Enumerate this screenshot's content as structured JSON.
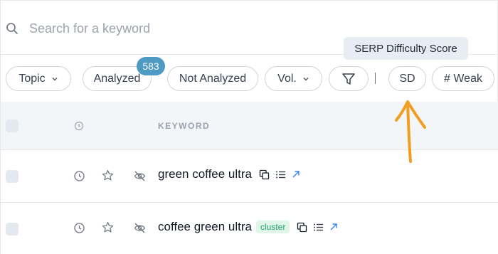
{
  "search": {
    "placeholder": "Search for a keyword",
    "value": ""
  },
  "tooltip": {
    "text": "SERP Difficulty Score"
  },
  "filters": {
    "topic_label": "Topic",
    "analyzed_label": "Analyzed",
    "analyzed_count": "583",
    "not_analyzed_label": "Not Analyzed",
    "volume_label": "Vol.",
    "divider": "|",
    "sd_label": "SD",
    "weak_label": "# Weak"
  },
  "table": {
    "header": {
      "keyword": "KEYWORD"
    },
    "rows": [
      {
        "keyword": "green coffee ultra",
        "tag": ""
      },
      {
        "keyword": "coffee green ultra",
        "tag": "cluster"
      }
    ]
  },
  "colors": {
    "badge": "#4e9ac2",
    "annotation_arrow": "#f29d1f",
    "tag_text": "#22a06b",
    "tag_bg": "#dff6e8",
    "link_icon": "#3b82f6"
  },
  "icons": [
    "search-icon",
    "chevron-down-icon",
    "filter-icon",
    "clock-icon",
    "star-icon",
    "eye-off-icon",
    "copy-icon",
    "list-icon",
    "external-link-icon"
  ]
}
